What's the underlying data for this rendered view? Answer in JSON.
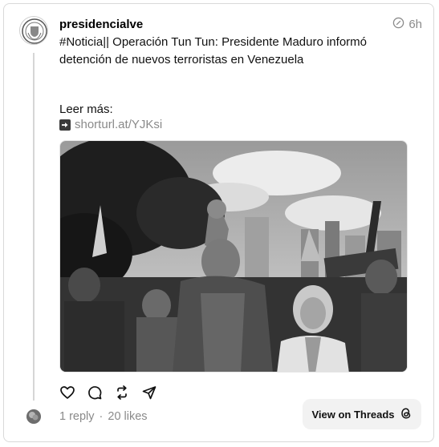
{
  "post": {
    "username": "presidencialve",
    "time": "6h",
    "text": "#Noticia|| Operación Tun Tun: Presidente Maduro informó detención de nuevos terroristas en Venezuela",
    "leer_mas": "Leer más:",
    "link": "shorturl.at/YJKsi"
  },
  "icons": {
    "meta": "edit-clock-icon",
    "link": "arrow-right-box-icon",
    "actions": [
      "heart-icon",
      "comment-icon",
      "repost-icon",
      "share-icon"
    ],
    "threads": "threads-logo-icon"
  },
  "stats": {
    "replies": "1 reply",
    "separator": "·",
    "likes": "20 likes"
  },
  "cta": {
    "label": "View on Threads"
  }
}
